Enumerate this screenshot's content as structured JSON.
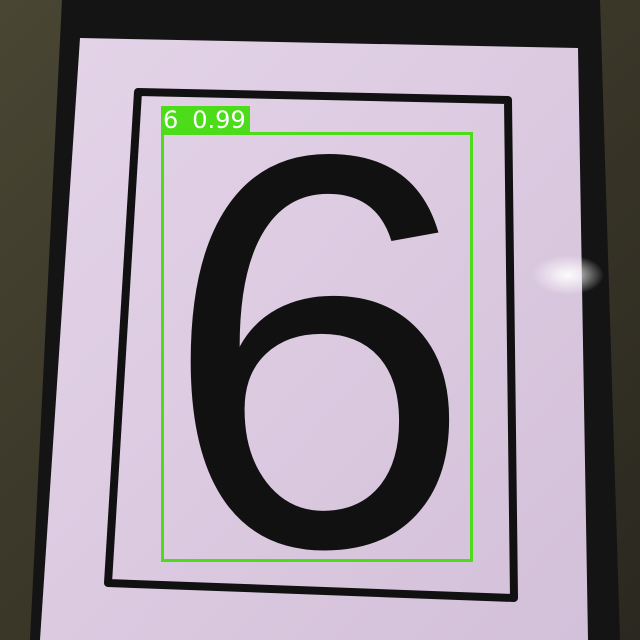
{
  "detection": {
    "class_label": "6",
    "confidence": "0.99",
    "box_color": "#4ddc1a"
  },
  "scene": {
    "depicted_digit": "6",
    "card_color": "#dccbe2",
    "frame_color": "#111111",
    "background_color": "#3a3628"
  }
}
